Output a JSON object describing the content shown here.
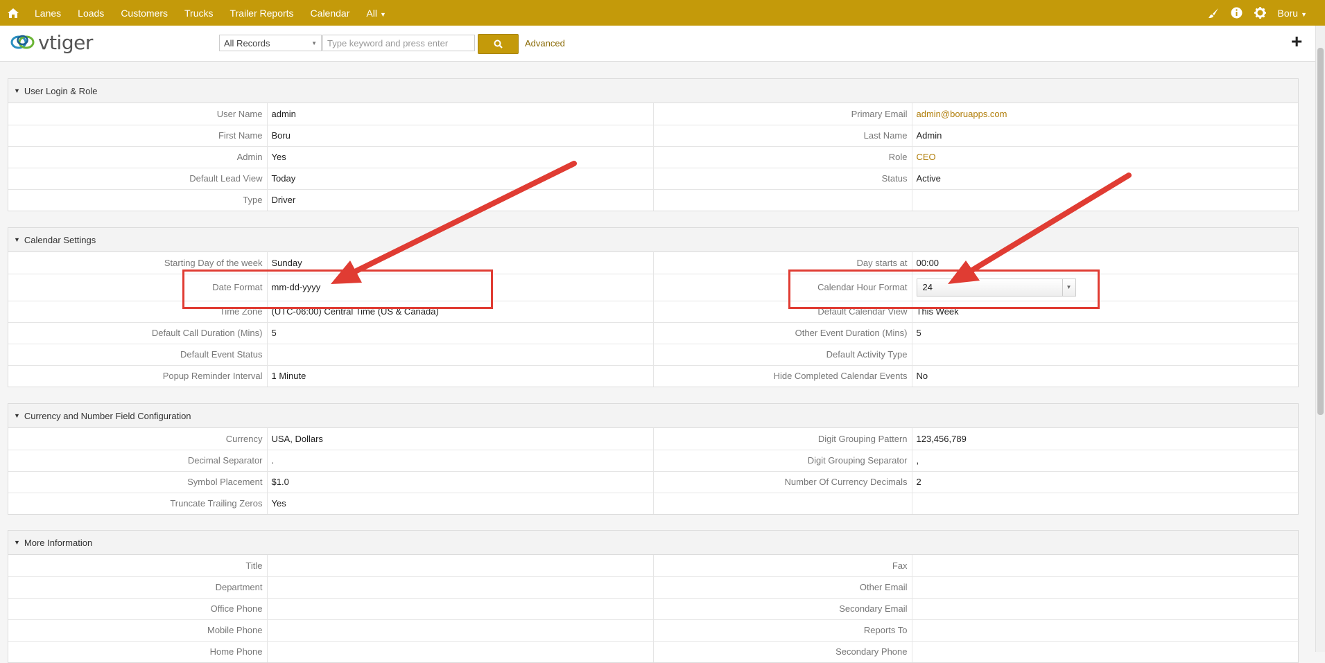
{
  "nav": {
    "items": [
      "Lanes",
      "Loads",
      "Customers",
      "Trucks",
      "Trailer Reports",
      "Calendar",
      "All"
    ],
    "user": "Boru"
  },
  "header": {
    "logo_text": "vtiger",
    "record_filter": "All Records",
    "search_placeholder": "Type keyword and press enter",
    "advanced_label": "Advanced"
  },
  "blocks": {
    "login": {
      "title": "User Login & Role",
      "rows": [
        [
          "User Name",
          "admin",
          "Primary Email",
          "admin@boruapps.com"
        ],
        [
          "First Name",
          "Boru",
          "Last Name",
          "Admin"
        ],
        [
          "Admin",
          "Yes",
          "Role",
          "CEO"
        ],
        [
          "Default Lead View",
          "Today",
          "Status",
          "Active"
        ],
        [
          "Type",
          "Driver",
          "",
          ""
        ]
      ]
    },
    "calendar": {
      "title": "Calendar Settings",
      "rows": [
        [
          "Starting Day of the week",
          "Sunday",
          "Day starts at",
          "00:00"
        ],
        [
          "Date Format",
          "mm-dd-yyyy",
          "Calendar Hour Format",
          "24"
        ],
        [
          "Time Zone",
          "(UTC-06:00) Central Time (US & Canada)",
          "Default Calendar View",
          "This Week"
        ],
        [
          "Default Call Duration (Mins)",
          "5",
          "Other Event Duration (Mins)",
          "5"
        ],
        [
          "Default Event Status",
          "",
          "Default Activity Type",
          ""
        ],
        [
          "Popup Reminder Interval",
          "1 Minute",
          "Hide Completed Calendar Events",
          "No"
        ]
      ]
    },
    "currency": {
      "title": "Currency and Number Field Configuration",
      "rows": [
        [
          "Currency",
          "USA, Dollars",
          "Digit Grouping Pattern",
          "123,456,789"
        ],
        [
          "Decimal Separator",
          ".",
          "Digit Grouping Separator",
          ","
        ],
        [
          "Symbol Placement",
          "$1.0",
          "Number Of Currency Decimals",
          "2"
        ],
        [
          "Truncate Trailing Zeros",
          "Yes",
          "",
          ""
        ]
      ]
    },
    "more": {
      "title": "More Information",
      "rows": [
        [
          "Title",
          "",
          "Fax",
          ""
        ],
        [
          "Department",
          "",
          "Other Email",
          ""
        ],
        [
          "Office Phone",
          "",
          "Secondary Email",
          ""
        ],
        [
          "Mobile Phone",
          "",
          "Reports To",
          ""
        ],
        [
          "Home Phone",
          "",
          "Secondary Phone",
          ""
        ]
      ]
    }
  },
  "colors": {
    "accent": "#c49a0a",
    "link": "#b07d08",
    "annotation": "#e03c33"
  }
}
